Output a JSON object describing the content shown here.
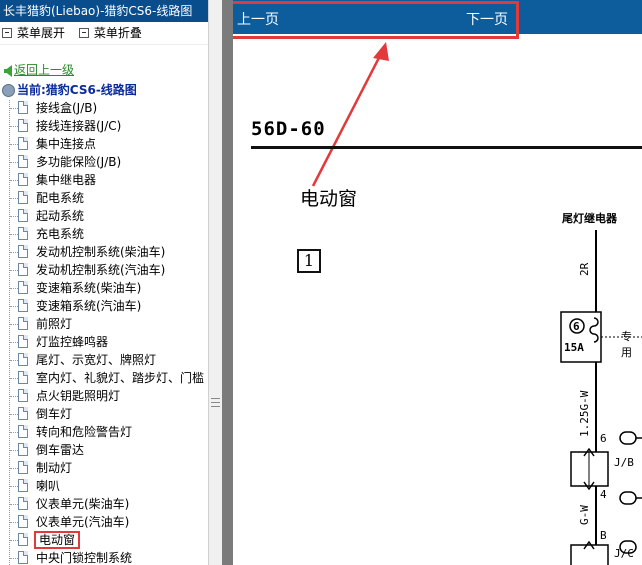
{
  "sidebar": {
    "title": "长丰猎豹(Liebao)-猎豹CS6-线路图",
    "expand_label": "菜单展开",
    "collapse_label": "菜单折叠",
    "back_label": "返回上一级",
    "current_label": "当前:猎豹CS6-线路图",
    "items": [
      {
        "label": "接线盒(J/B)"
      },
      {
        "label": "接线连接器(J/C)"
      },
      {
        "label": "集中连接点"
      },
      {
        "label": "多功能保险(J/B)"
      },
      {
        "label": "集中继电器"
      },
      {
        "label": "配电系统"
      },
      {
        "label": "起动系统"
      },
      {
        "label": "充电系统"
      },
      {
        "label": "发动机控制系统(柴油车)"
      },
      {
        "label": "发动机控制系统(汽油车)"
      },
      {
        "label": "变速箱系统(柴油车)"
      },
      {
        "label": "变速箱系统(汽油车)"
      },
      {
        "label": "前照灯"
      },
      {
        "label": "灯监控蜂鸣器"
      },
      {
        "label": "尾灯、示宽灯、牌照灯"
      },
      {
        "label": "室内灯、礼貌灯、踏步灯、门槛"
      },
      {
        "label": "点火钥匙照明灯"
      },
      {
        "label": "倒车灯"
      },
      {
        "label": "转向和危险警告灯"
      },
      {
        "label": "倒车雷达"
      },
      {
        "label": "制动灯"
      },
      {
        "label": "喇叭"
      },
      {
        "label": "仪表单元(柴油车)"
      },
      {
        "label": "仪表单元(汽油车)"
      },
      {
        "label": "电动窗",
        "selected": true
      },
      {
        "label": "中央门锁控制系统"
      }
    ]
  },
  "viewer": {
    "prev_label": "上一页",
    "next_label": "下一页",
    "page_code": "56D-60",
    "diagram_title": "电动窗",
    "box_number": "1",
    "relay_label": "尾灯继电器",
    "wire_2r": "2R",
    "fuse_number": "6",
    "fuse_rating": "15A",
    "fuse_side_label": "专用",
    "wire_125gw": "1.25G-W",
    "pin_6": "6",
    "jb_label": "J/B",
    "pin_4": "4",
    "wire_gw": "G-W",
    "pin_b": "B",
    "jc_label": "J/C"
  },
  "colors": {
    "title_bar": "#0a4d8c",
    "nav_bar": "#0d5d9c",
    "highlight": "#e23a3a",
    "back_link": "#2a8a2a",
    "current_text": "#0a2a9a"
  }
}
